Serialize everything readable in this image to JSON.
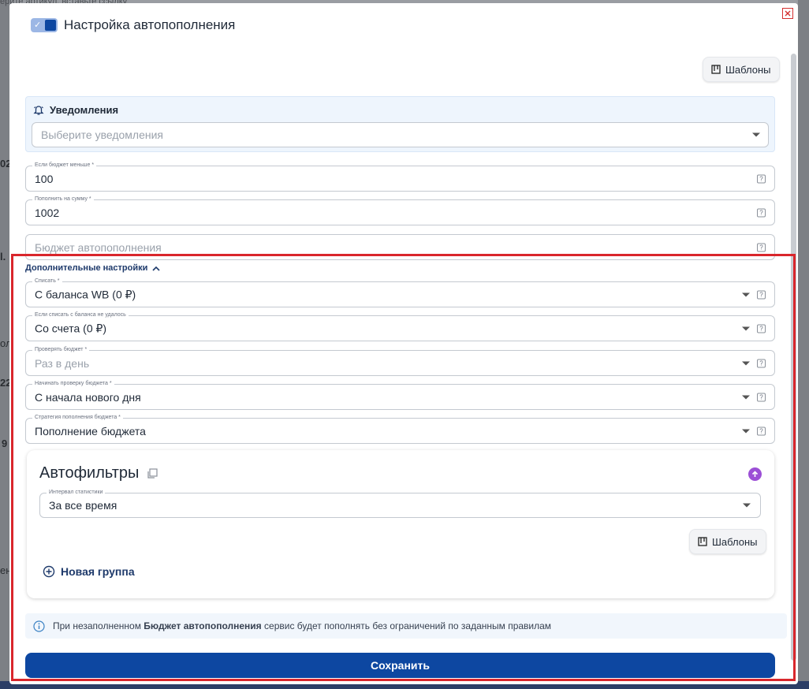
{
  "modal": {
    "title": "Настройка автопополнения",
    "templates_label": "Шаблоны"
  },
  "notifications": {
    "title": "Уведомления",
    "placeholder": "Выберите уведомления"
  },
  "fields": [
    {
      "label": "Если бюджет меньше *",
      "value": "100"
    },
    {
      "label": "Пополнить на сумму *",
      "value": "1002"
    },
    {
      "label": "",
      "placeholder": "Бюджет автопополнения"
    }
  ],
  "advanced": {
    "toggle_label": "Дополнительные настройки",
    "selects": [
      {
        "label": "Списать *",
        "value": "С баланса WB (0 ₽)"
      },
      {
        "label": "Если списать с баланса не удалось",
        "value": "Со счета (0 ₽)"
      },
      {
        "label": "Проверять бюджет *",
        "value": "Раз в день",
        "placeholder": true
      },
      {
        "label": "Начинать проверку бюджета *",
        "value": "С начала нового дня"
      },
      {
        "label": "Стратегия пополнения бюджета *",
        "value": "Пополнение бюджета"
      }
    ]
  },
  "autofilters": {
    "title": "Автофильтры",
    "interval_label": "Интервал статистики",
    "interval_value": "За все время",
    "templates_label": "Шаблоны",
    "new_group": "Новая группа"
  },
  "info": {
    "prefix": "При незаполненном",
    "bold": "Бюджет автопополнения",
    "suffix": "сервис будет пополнять без ограничений по заданным правилам"
  },
  "save_label": "Сохранить",
  "background": {
    "frag1": "ерите артикул, вставьте ссылку",
    "frag2": "02",
    "frag3": "l.",
    "frag4": "ол",
    "frag5": "22",
    "frag6": "9",
    "frag7": "ен"
  },
  "colors": {
    "primary": "#0d47a1",
    "highlight_frame": "#d9262c",
    "accent_purple": "#9c4fd6"
  }
}
